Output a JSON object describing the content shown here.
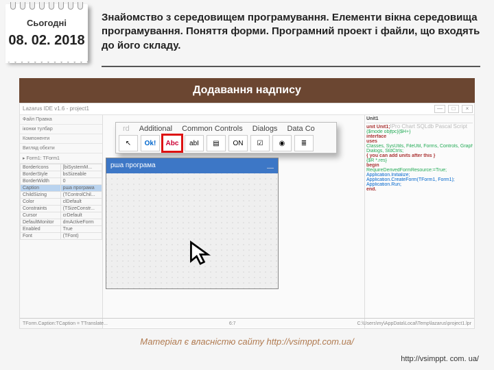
{
  "header": {
    "today_label": "Сьогодні",
    "date": "08. 02. 2018",
    "topic": "Знайомство з середовищем програмування. Елементи вікна середовища програмування. Поняття форми. Програмний проект і файли, що входять до його складу."
  },
  "banner": "Додавання надпису",
  "ide": {
    "title": "Lazarus IDE v1.6 - project1",
    "win_buttons": [
      "—",
      "□",
      "×"
    ],
    "left_panel": {
      "l1": "Файл Правка",
      "l2": "іконки тулбар",
      "l3": "Компоненти",
      "l4": "Вигляд обєкти",
      "l5": "▸ Form1: TForm1"
    },
    "palette": {
      "tabs_left_faded": "rd",
      "tabs": [
        "Additional",
        "Common Controls",
        "Dialogs",
        "Data Co"
      ],
      "tabs_right_faded": "IPro   Chart   SQLdb   Pascal Script",
      "tools": {
        "cursor": "↖",
        "ok": "Ok!",
        "abc": "Abc",
        "abi": "abI",
        "doc": "▤",
        "on": "ON",
        "chk": "☑",
        "radio": "◉",
        "list": "≣"
      }
    },
    "form": {
      "title": "рша програма",
      "min": "—"
    },
    "properties": {
      "rows": [
        [
          "BorderIcons",
          "[biSystemM..."
        ],
        [
          "BorderStyle",
          "bsSizeable"
        ],
        [
          "BorderWidth",
          "0"
        ],
        [
          "Caption",
          "рша програма"
        ],
        [
          "ChildSizing",
          "(TControlChil..."
        ],
        [
          "Color",
          "clDefault"
        ],
        [
          "Constraints",
          "(TSizeConstr..."
        ],
        [
          "Cursor",
          "crDefault"
        ],
        [
          "DefaultMonitor",
          "dmActiveForm"
        ],
        [
          "Enabled",
          "True"
        ],
        [
          "Font",
          "(TFont)"
        ]
      ],
      "highlight_index": 3
    },
    "code": {
      "header": "Unit1",
      "lines": [
        "unit Unit1;",
        "{$mode objfpc}{$H+}",
        "interface",
        "uses",
        "  Classes, SysUtils, FileUtil, Forms, Controls, Graphics,",
        "  Dialogs, StdCtrls;",
        "{ you can add units after this }",
        "",
        "{$R *.res}",
        "",
        "begin",
        "  RequireDerivedFormResource:=True;",
        "  Application.Initialize;",
        "  Application.CreateForm(TForm1, Form1);",
        "  Application.Run;",
        "end."
      ]
    },
    "status": {
      "left": "TForm.Caption:TCaption = TTranslate...",
      "mid": "6:7",
      "right": "C:\\Users\\my\\AppData\\Local\\Temp\\lazarus\\project1.lpr"
    }
  },
  "footer": {
    "credit": "Матеріал є власністю сайту http://vsimppt.com.ua/",
    "url": "http://vsimppt. com. ua/"
  }
}
